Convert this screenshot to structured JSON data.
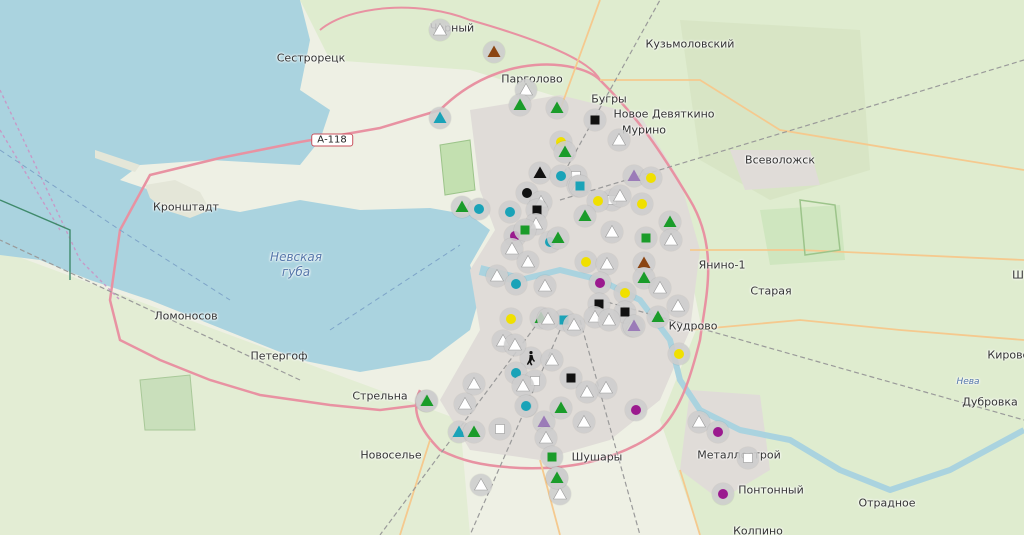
{
  "map": {
    "labels": [
      {
        "id": "chernyy",
        "text": "Черный",
        "kind": "place"
      },
      {
        "id": "kuzmolovskiy",
        "text": "Кузьмоловский",
        "kind": "place"
      },
      {
        "id": "sestroretsk",
        "text": "Сестрорецк",
        "kind": "place"
      },
      {
        "id": "pargolovo",
        "text": "Парголово",
        "kind": "place"
      },
      {
        "id": "bugry",
        "text": "Бугры",
        "kind": "place"
      },
      {
        "id": "novoe-devyatkino",
        "text": "Новое Девяткино",
        "kind": "place"
      },
      {
        "id": "murino",
        "text": "Мурино",
        "kind": "place"
      },
      {
        "id": "vsevolozhsk",
        "text": "Всеволожск",
        "kind": "place"
      },
      {
        "id": "kronshtadt",
        "text": "Кронштадт",
        "kind": "place"
      },
      {
        "id": "nevskaya-guba",
        "text": "Невская\nгуба",
        "kind": "water"
      },
      {
        "id": "yanino",
        "text": "Янино-1",
        "kind": "place"
      },
      {
        "id": "staraya",
        "text": "Старая",
        "kind": "place"
      },
      {
        "id": "lomonosov",
        "text": "Ломоносов",
        "kind": "place"
      },
      {
        "id": "kudrovo",
        "text": "Кудрово",
        "kind": "place"
      },
      {
        "id": "petergof",
        "text": "Петергоф",
        "kind": "place"
      },
      {
        "id": "kirovsk",
        "text": "Кировс",
        "kind": "place"
      },
      {
        "id": "neva",
        "text": "Нева",
        "kind": "river"
      },
      {
        "id": "strelna",
        "text": "Стрельна",
        "kind": "place"
      },
      {
        "id": "dubrovka",
        "text": "Дубровка",
        "kind": "place"
      },
      {
        "id": "novoselye",
        "text": "Новоселье",
        "kind": "place"
      },
      {
        "id": "shushary",
        "text": "Шушары",
        "kind": "place"
      },
      {
        "id": "metallostroy",
        "text": "Металлострой",
        "kind": "place"
      },
      {
        "id": "pontonnyy",
        "text": "Понтонный",
        "kind": "place"
      },
      {
        "id": "otradnoe",
        "text": "Отрадное",
        "kind": "place"
      },
      {
        "id": "kolpino",
        "text": "Колпино",
        "kind": "place"
      },
      {
        "id": "sh",
        "text": "Ш",
        "kind": "place"
      }
    ],
    "road_shields": [
      {
        "id": "a118",
        "text": "А-118"
      }
    ],
    "colors": {
      "water": "#aad3df",
      "land": "#f2efe9",
      "green": "#cfe6bf",
      "city": "#dedbd7",
      "ring_road": "#e892a2",
      "primary_road": "#fcd6a4",
      "rail": "#8a8a8a",
      "border": "#ac46ac"
    },
    "marker_types": {
      "triangle-white": {
        "shape": "triangle",
        "color": "#ffffff"
      },
      "triangle-green": {
        "shape": "triangle",
        "color": "#1a9c2a"
      },
      "triangle-teal": {
        "shape": "triangle",
        "color": "#1aa3b8"
      },
      "triangle-brown": {
        "shape": "triangle",
        "color": "#8b4513"
      },
      "triangle-black": {
        "shape": "triangle",
        "color": "#111111"
      },
      "triangle-purple": {
        "shape": "triangle",
        "color": "#9b7bb8"
      },
      "circle-teal": {
        "shape": "circle",
        "color": "#1aa3b8"
      },
      "circle-black": {
        "shape": "circle",
        "color": "#111111"
      },
      "circle-yellow": {
        "shape": "circle",
        "color": "#f0e000"
      },
      "circle-purple": {
        "shape": "circle",
        "color": "#9b1a8f"
      },
      "square-black": {
        "shape": "square",
        "color": "#111111"
      },
      "square-green": {
        "shape": "square",
        "color": "#1a9c2a"
      },
      "square-white": {
        "shape": "square",
        "color": "#ffffff"
      },
      "square-teal": {
        "shape": "square",
        "color": "#1aa3b8"
      },
      "pedestrian-black": {
        "shape": "person",
        "color": "#111111"
      }
    },
    "markers": [
      {
        "type": "triangle-white"
      },
      {
        "type": "triangle-brown"
      },
      {
        "type": "triangle-white"
      },
      {
        "type": "triangle-teal"
      },
      {
        "type": "triangle-green"
      },
      {
        "type": "square-black"
      },
      {
        "type": "triangle-green"
      },
      {
        "type": "triangle-white"
      },
      {
        "type": "circle-yellow"
      },
      {
        "type": "triangle-green"
      },
      {
        "type": "square-white"
      },
      {
        "type": "triangle-black"
      },
      {
        "type": "circle-teal"
      },
      {
        "type": "triangle-white"
      },
      {
        "type": "circle-black"
      },
      {
        "type": "square-teal"
      },
      {
        "type": "triangle-purple"
      },
      {
        "type": "circle-yellow"
      },
      {
        "type": "square-white"
      },
      {
        "type": "triangle-white"
      },
      {
        "type": "triangle-white"
      },
      {
        "type": "triangle-green"
      },
      {
        "type": "circle-teal"
      },
      {
        "type": "circle-teal"
      },
      {
        "type": "square-black"
      },
      {
        "type": "circle-yellow"
      },
      {
        "type": "triangle-white"
      },
      {
        "type": "circle-yellow"
      },
      {
        "type": "triangle-green"
      },
      {
        "type": "triangle-green"
      },
      {
        "type": "square-green"
      },
      {
        "type": "triangle-white"
      },
      {
        "type": "triangle-white"
      },
      {
        "type": "circle-purple"
      },
      {
        "type": "circle-teal"
      },
      {
        "type": "triangle-green"
      },
      {
        "type": "square-green"
      },
      {
        "type": "triangle-white"
      },
      {
        "type": "triangle-white"
      },
      {
        "type": "circle-yellow"
      },
      {
        "type": "triangle-brown"
      },
      {
        "type": "triangle-white"
      },
      {
        "type": "triangle-white"
      },
      {
        "type": "triangle-green"
      },
      {
        "type": "circle-purple"
      },
      {
        "type": "circle-teal"
      },
      {
        "type": "triangle-white"
      },
      {
        "type": "triangle-white"
      },
      {
        "type": "square-black"
      },
      {
        "type": "circle-yellow"
      },
      {
        "type": "triangle-green"
      },
      {
        "type": "triangle-white"
      },
      {
        "type": "square-teal"
      },
      {
        "type": "square-black"
      },
      {
        "type": "triangle-white"
      },
      {
        "type": "triangle-green"
      },
      {
        "type": "triangle-purple"
      },
      {
        "type": "circle-yellow"
      },
      {
        "type": "triangle-white"
      },
      {
        "type": "triangle-white"
      },
      {
        "type": "triangle-white"
      },
      {
        "type": "circle-yellow"
      },
      {
        "type": "triangle-white"
      },
      {
        "type": "pedestrian-black"
      },
      {
        "type": "triangle-white"
      },
      {
        "type": "circle-teal"
      },
      {
        "type": "triangle-white"
      },
      {
        "type": "square-black"
      },
      {
        "type": "triangle-white"
      },
      {
        "type": "triangle-green"
      },
      {
        "type": "triangle-white"
      },
      {
        "type": "square-white"
      },
      {
        "type": "circle-teal"
      },
      {
        "type": "triangle-purple"
      },
      {
        "type": "triangle-white"
      },
      {
        "type": "circle-purple"
      },
      {
        "type": "triangle-green"
      },
      {
        "type": "triangle-white"
      },
      {
        "type": "triangle-teal"
      },
      {
        "type": "triangle-green"
      },
      {
        "type": "square-white"
      },
      {
        "type": "triangle-white"
      },
      {
        "type": "triangle-white"
      },
      {
        "type": "square-green"
      },
      {
        "type": "triangle-white"
      },
      {
        "type": "triangle-white"
      },
      {
        "type": "circle-purple"
      },
      {
        "type": "square-white"
      },
      {
        "type": "circle-purple"
      },
      {
        "type": "triangle-white"
      },
      {
        "type": "triangle-green"
      },
      {
        "type": "triangle-white"
      },
      {
        "type": "triangle-white"
      },
      {
        "type": "triangle-white"
      },
      {
        "type": "triangle-green"
      },
      {
        "type": "circle-teal"
      }
    ]
  }
}
